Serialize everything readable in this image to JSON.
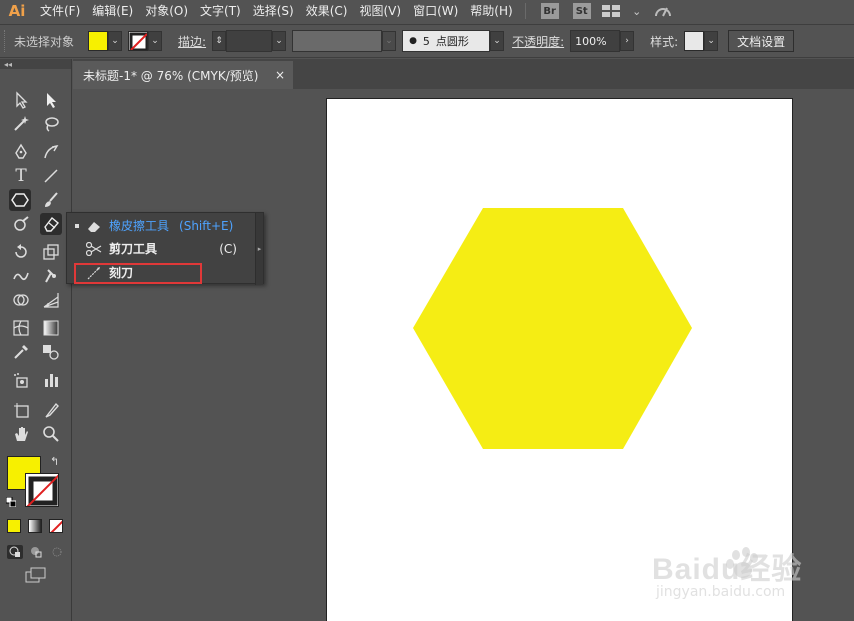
{
  "menubar": {
    "logo": "Ai",
    "items": [
      "文件(F)",
      "编辑(E)",
      "对象(O)",
      "文字(T)",
      "选择(S)",
      "效果(C)",
      "视图(V)",
      "窗口(W)",
      "帮助(H)"
    ],
    "badges": [
      "Br",
      "St"
    ]
  },
  "controlbar": {
    "selection_status": "未选择对象",
    "fill_color": "#f7f000",
    "stroke_label": "描边:",
    "brush_size": "5",
    "brush_shape": "点圆形",
    "opacity_label": "不透明度:",
    "opacity_value": "100%",
    "style_label": "样式:",
    "doc_settings": "文档设置"
  },
  "document": {
    "tab_title": "未标题-1* @ 76% (CMYK/预览)",
    "close_glyph": "×",
    "shape_color": "#f5ed14"
  },
  "flyout": {
    "items": [
      {
        "label": "橡皮擦工具",
        "shortcut": "(Shift+E)",
        "icon": "eraser-icon",
        "active": true
      },
      {
        "label": "剪刀工具",
        "shortcut": "(C)",
        "icon": "scissors-icon",
        "active": false
      },
      {
        "label": "刻刀",
        "shortcut": "",
        "icon": "knife-icon",
        "active": false
      }
    ]
  },
  "colors": {
    "accent_blue": "#4ea3ff",
    "highlight_red": "#e03838",
    "fill_swatch": "#f7f000"
  },
  "watermark": {
    "brand": "Baidu经验",
    "url": "jingyan.baidu.com"
  }
}
